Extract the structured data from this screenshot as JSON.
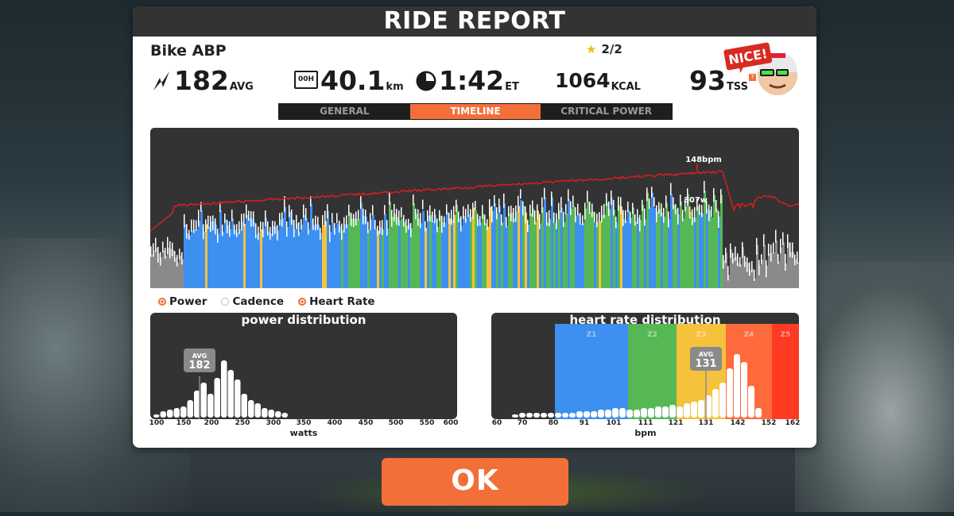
{
  "window": {
    "title": "RIDE REPORT"
  },
  "ride": {
    "bike": "Bike ABP",
    "stars": "2/2",
    "power_value": "182",
    "power_unit": "AVG",
    "distance_value": "40.1",
    "distance_unit": "km",
    "time_value": "1:42",
    "time_unit": "ET",
    "calories_value": "1064",
    "calories_unit": "KCAL",
    "tss_value": "93",
    "tss_unit": "TSS",
    "badge": "NICE!",
    "time_icon_text": "00H"
  },
  "tabs": [
    {
      "label": "GENERAL",
      "active": false
    },
    {
      "label": "TIMELINE",
      "active": true
    },
    {
      "label": "CRITICAL POWER",
      "active": false
    }
  ],
  "timeline": {
    "hr_peak_label": "148bpm",
    "power_peak_label": "307w"
  },
  "legend": [
    {
      "label": "Power",
      "on": true
    },
    {
      "label": "Cadence",
      "on": false
    },
    {
      "label": "Heart Rate",
      "on": true
    }
  ],
  "colors": {
    "accent": "#f36f3a",
    "dark": "#333334",
    "hr_line": "#e31e1e",
    "z1": "#3d8ff0",
    "z2": "#56b854",
    "z3": "#f6c23c",
    "z4": "#ff6a3c",
    "z5": "#ff3a22"
  },
  "power_distribution": {
    "title": "power distribution",
    "avg_label": "AVG",
    "avg_value": "182",
    "x_ticks": [
      "100",
      "150",
      "200",
      "250",
      "300",
      "350",
      "400",
      "450",
      "500",
      "550",
      "600"
    ],
    "axis_title": "watts"
  },
  "hr_distribution": {
    "title": "heart rate distribution",
    "avg_label": "AVG",
    "avg_value": "131",
    "zones": [
      "Z1",
      "Z2",
      "Z3",
      "Z4",
      "Z5"
    ],
    "x_ticks": [
      "60",
      "70",
      "80",
      "91",
      "101",
      "111",
      "121",
      "131",
      "142",
      "152",
      "162"
    ],
    "axis_title": "bpm"
  },
  "buttons": {
    "ok": "OK"
  }
}
